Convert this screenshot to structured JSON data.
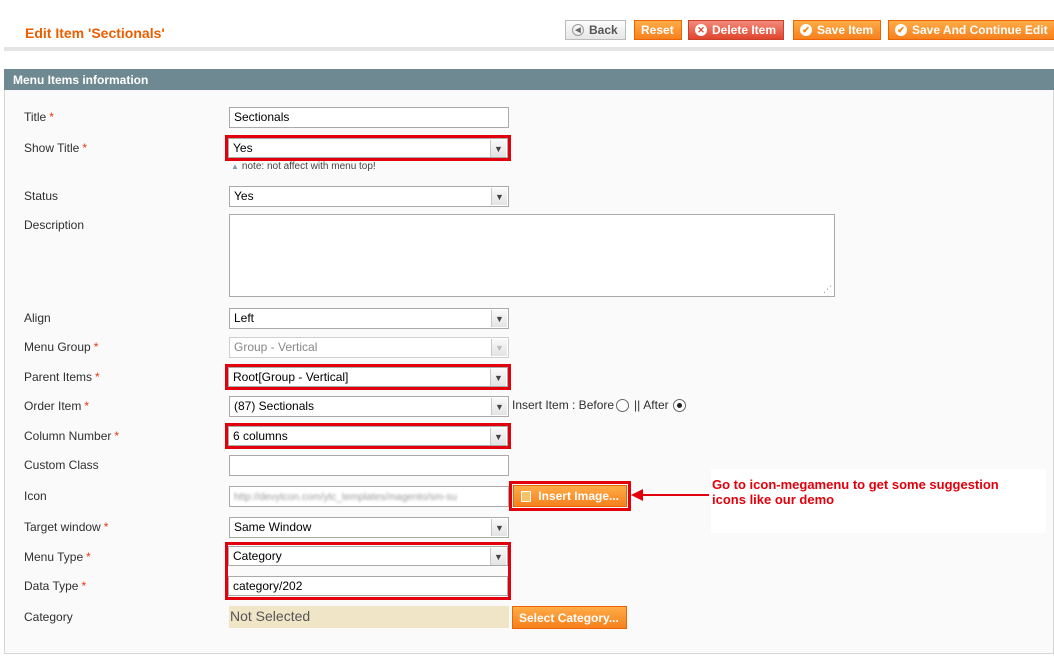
{
  "header": {
    "title": "Edit Item 'Sectionals'",
    "buttons": {
      "back": "Back",
      "reset": "Reset",
      "delete": "Delete Item",
      "save": "Save Item",
      "save_continue": "Save And Continue Edit"
    }
  },
  "section": {
    "title": "Menu Items information"
  },
  "form": {
    "title": {
      "label": "Title",
      "value": "Sectionals"
    },
    "show_title": {
      "label": "Show Title",
      "value": "Yes",
      "note": "note: not affect with menu top!"
    },
    "status": {
      "label": "Status",
      "value": "Yes"
    },
    "description": {
      "label": "Description",
      "value": ""
    },
    "align": {
      "label": "Align",
      "value": "Left"
    },
    "menu_group": {
      "label": "Menu Group",
      "value": "Group - Vertical"
    },
    "parent_items": {
      "label": "Parent Items",
      "value": "Root[Group - Vertical]"
    },
    "order_item": {
      "label": "Order Item",
      "value": "(87) Sectionals",
      "insert_label": "Insert Item : Before",
      "separator": "||",
      "after_label": "After",
      "selected_position": "After"
    },
    "column_number": {
      "label": "Column Number",
      "value": "6 columns"
    },
    "custom_class": {
      "label": "Custom Class",
      "value": ""
    },
    "icon": {
      "label": "Icon",
      "value": "http://devytcon.com/ytc_templates/magento/sm-su",
      "button": "Insert Image..."
    },
    "target_window": {
      "label": "Target window",
      "value": "Same Window"
    },
    "menu_type": {
      "label": "Menu Type",
      "value": "Category"
    },
    "data_type": {
      "label": "Data Type",
      "value": "category/202"
    },
    "category": {
      "label": "Category",
      "value": "Not Selected",
      "button": "Select Category..."
    },
    "required_mark": "*"
  },
  "annotation": {
    "text": "Go to icon-megamenu to get some suggestion icons like our demo",
    "color": "#e1000b"
  },
  "colors": {
    "accent": "#eb5e00",
    "section_header": "#6f8992",
    "highlight": "#e1000b"
  }
}
